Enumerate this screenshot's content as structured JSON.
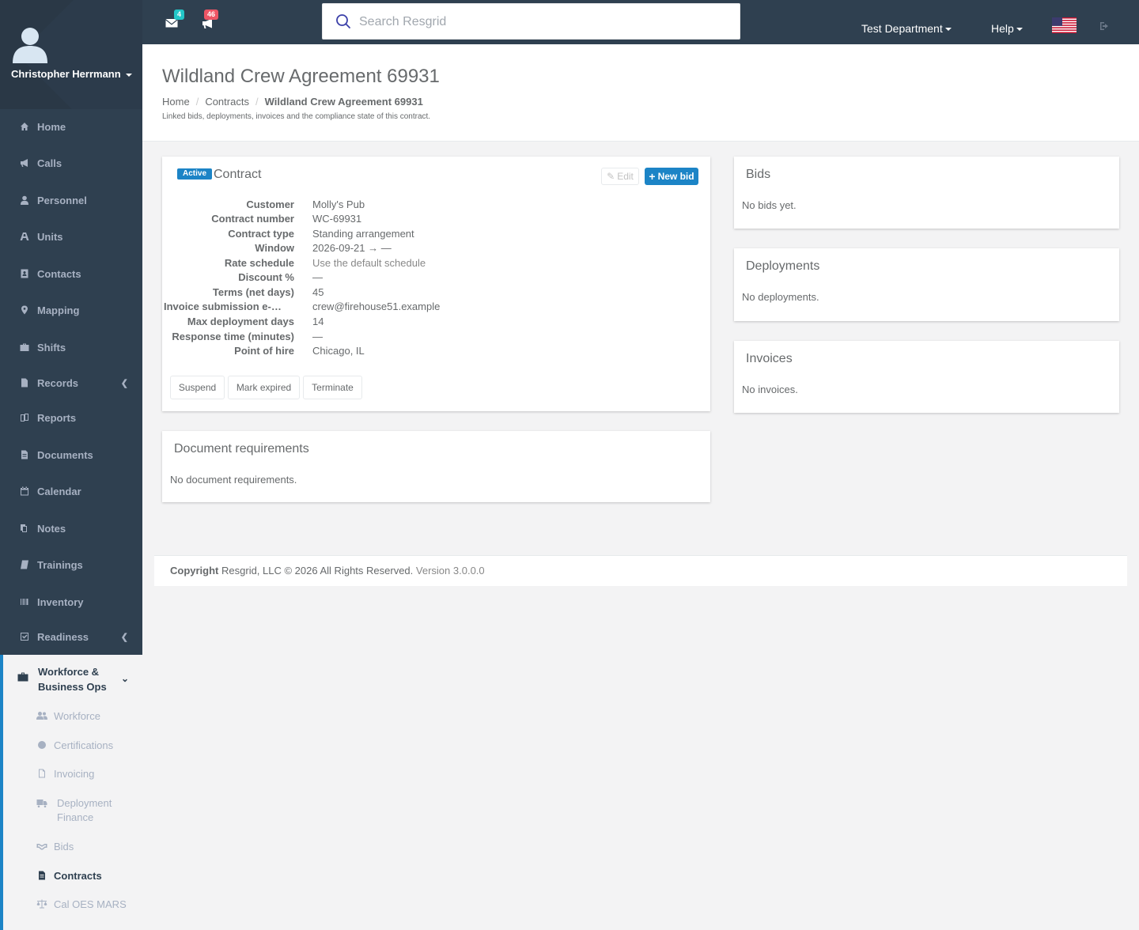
{
  "user": {
    "name": "Christopher Herrmann"
  },
  "sidebar": {
    "items": [
      {
        "label": "Home",
        "icon": "home-icon"
      },
      {
        "label": "Calls",
        "icon": "bullhorn-icon"
      },
      {
        "label": "Personnel",
        "icon": "user-icon"
      },
      {
        "label": "Units",
        "icon": "truck-icon"
      },
      {
        "label": "Contacts",
        "icon": "address-book-icon"
      },
      {
        "label": "Mapping",
        "icon": "map-marker-icon"
      },
      {
        "label": "Shifts",
        "icon": "briefcase-icon"
      },
      {
        "label": "Records",
        "icon": "file-icon"
      },
      {
        "label": "Reports",
        "icon": "reports-icon"
      },
      {
        "label": "Documents",
        "icon": "document-icon"
      },
      {
        "label": "Calendar",
        "icon": "calendar-icon"
      },
      {
        "label": "Notes",
        "icon": "notes-icon"
      },
      {
        "label": "Trainings",
        "icon": "book-icon"
      },
      {
        "label": "Inventory",
        "icon": "barcode-icon"
      },
      {
        "label": "Readiness",
        "icon": "check-square-icon"
      }
    ],
    "group": {
      "label": "Workforce & Business Ops",
      "subitems": [
        {
          "label": "Workforce",
          "icon": "users-icon"
        },
        {
          "label": "Certifications",
          "icon": "certificate-icon"
        },
        {
          "label": "Invoicing",
          "icon": "invoice-icon"
        },
        {
          "label": "Deployment Finance",
          "icon": "truck-icon"
        },
        {
          "label": "Bids",
          "icon": "handshake-icon"
        },
        {
          "label": "Contracts",
          "icon": "file-text-icon"
        },
        {
          "label": "Cal OES MARS",
          "icon": "balance-scale-icon"
        }
      ]
    }
  },
  "topbar": {
    "messages_count": "4",
    "calls_count": "46",
    "search_placeholder": "Search Resgrid",
    "department": "Test Department",
    "help": "Help",
    "badge_colors": {
      "messages": "#23c6c8",
      "calls": "#ed5565"
    }
  },
  "header": {
    "title": "Wildland Crew Agreement 69931",
    "breadcrumb": [
      "Home",
      "Contracts",
      "Wildland Crew Agreement 69931"
    ],
    "subtitle": "Linked bids, deployments, invoices and the compliance state of this contract."
  },
  "contract": {
    "status": "Active",
    "title": "Contract",
    "edit_label": "Edit",
    "new_bid_label": "New bid",
    "fields": [
      {
        "label": "Customer",
        "value": "Molly's Pub"
      },
      {
        "label": "Contract number",
        "value": "WC-69931"
      },
      {
        "label": "Contract type",
        "value": "Standing arrangement"
      },
      {
        "label": "Window",
        "value": "2026-09-21 → —"
      },
      {
        "label": "Rate schedule",
        "value": "Use the default schedule"
      },
      {
        "label": "Discount %",
        "value": "—"
      },
      {
        "label": "Terms (net days)",
        "value": "45"
      },
      {
        "label": "Invoice submission e-mail",
        "value": "crew@firehouse51.example"
      },
      {
        "label": "Max deployment days",
        "value": "14"
      },
      {
        "label": "Response time (minutes)",
        "value": "—"
      },
      {
        "label": "Point of hire",
        "value": "Chicago, IL"
      }
    ],
    "actions": [
      "Suspend",
      "Mark expired",
      "Terminate"
    ]
  },
  "documents": {
    "title": "Document requirements",
    "empty": "No document requirements."
  },
  "bids": {
    "title": "Bids",
    "empty": "No bids yet."
  },
  "deployments": {
    "title": "Deployments",
    "empty": "No deployments."
  },
  "invoices": {
    "title": "Invoices",
    "empty": "No invoices."
  },
  "footer": {
    "copyright_label": "Copyright",
    "copyright_text": "Resgrid, LLC © 2026 All Rights Reserved.",
    "version": "Version 3.0.0.0"
  },
  "colors": {
    "sidebar": "#2f4050",
    "accent": "#1c84c6"
  }
}
